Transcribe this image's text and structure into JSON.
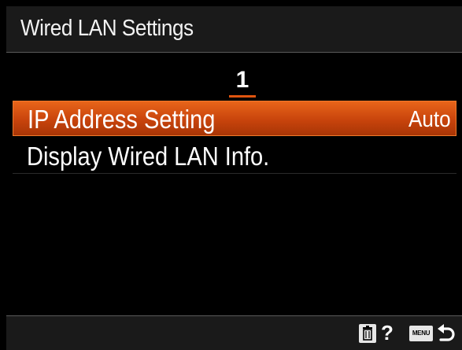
{
  "header": {
    "title": "Wired LAN Settings"
  },
  "page": {
    "current": "1"
  },
  "menu": {
    "items": [
      {
        "label": "IP Address Setting",
        "value": "Auto",
        "selected": true
      },
      {
        "label": "Display Wired LAN Info.",
        "value": "",
        "selected": false
      }
    ]
  },
  "footer": {
    "help_label": "?",
    "menu_button_label": "MENU",
    "icons": [
      "trash-icon",
      "menu-button-icon",
      "back-arrow-icon"
    ]
  },
  "colors": {
    "background": "#000000",
    "bar_background": "#1a1a1a",
    "accent_orange": "#e0540f",
    "selected_top": "#e8651a",
    "selected_bottom": "#a83506",
    "text": "#ffffff"
  }
}
